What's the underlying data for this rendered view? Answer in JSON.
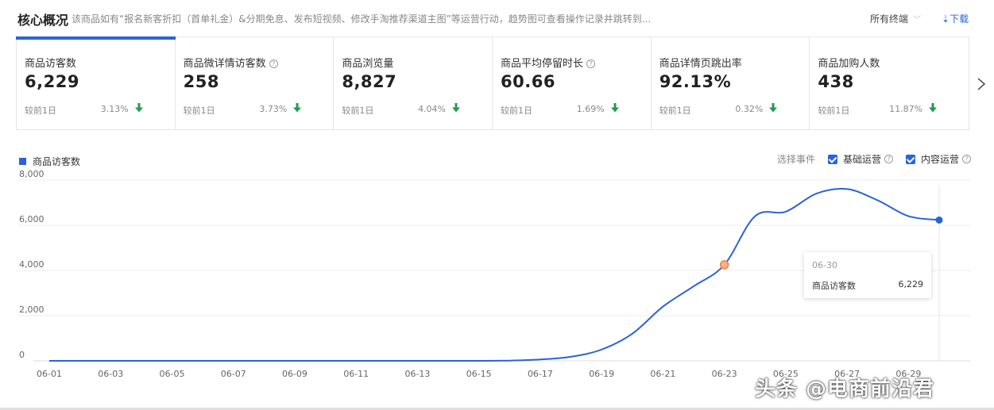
{
  "header": {
    "title": "核心概况",
    "description": "该商品如有“报名新客折扣（首单礼金）&分期免息、发布短视频、修改手淘推荐渠道主图”等运营行动，趋势图可查看操作记录并跳转到...",
    "terminal": "所有终端",
    "download": "下载"
  },
  "metrics": [
    {
      "label": "商品访客数",
      "value": "6,229",
      "compare": "较前1日",
      "change": "3.13%",
      "has_help": false
    },
    {
      "label": "商品微详情访客数",
      "value": "258",
      "compare": "较前1日",
      "change": "3.73%",
      "has_help": true
    },
    {
      "label": "商品浏览量",
      "value": "8,827",
      "compare": "较前1日",
      "change": "4.04%",
      "has_help": false
    },
    {
      "label": "商品平均停留时长",
      "value": "60.66",
      "compare": "较前1日",
      "change": "1.69%",
      "has_help": true
    },
    {
      "label": "商品详情页跳出率",
      "value": "92.13%",
      "compare": "较前1日",
      "change": "0.32%",
      "has_help": false
    },
    {
      "label": "商品加购人数",
      "value": "438",
      "compare": "较前1日",
      "change": "11.87%",
      "has_help": false
    }
  ],
  "legend": {
    "series_name": "商品访客数",
    "color": "#2a63d8"
  },
  "events": {
    "label": "选择事件",
    "options": [
      {
        "label": "基础运营",
        "checked": true
      },
      {
        "label": "内容运营",
        "checked": true
      }
    ]
  },
  "tooltip": {
    "date": "06-30",
    "name": "商品访客数",
    "value": "6,229"
  },
  "chart_data": {
    "type": "line",
    "x": [
      "06-01",
      "06-02",
      "06-03",
      "06-04",
      "06-05",
      "06-06",
      "06-07",
      "06-08",
      "06-09",
      "06-10",
      "06-11",
      "06-12",
      "06-13",
      "06-14",
      "06-15",
      "06-16",
      "06-17",
      "06-18",
      "06-19",
      "06-20",
      "06-21",
      "06-22",
      "06-23",
      "06-24",
      "06-25",
      "06-26",
      "06-27",
      "06-28",
      "06-29",
      "06-30"
    ],
    "xticks": [
      "06-01",
      "06-03",
      "06-05",
      "06-07",
      "06-09",
      "06-11",
      "06-13",
      "06-15",
      "06-17",
      "06-19",
      "06-21",
      "06-23",
      "06-25",
      "06-27",
      "06-29"
    ],
    "series": [
      {
        "name": "商品访客数",
        "color": "#2a63d8",
        "values": [
          0,
          0,
          0,
          0,
          0,
          0,
          0,
          0,
          0,
          0,
          0,
          0,
          0,
          0,
          0,
          10,
          60,
          180,
          500,
          1200,
          2400,
          3300,
          4250,
          6400,
          6600,
          7400,
          7600,
          7100,
          6400,
          6229
        ]
      }
    ],
    "yticks": [
      0,
      2000,
      4000,
      6000,
      8000
    ],
    "ylim": [
      0,
      8000
    ],
    "grid": true,
    "highlight_index": 22,
    "hover_index": 29
  },
  "watermark": "头条 @电商前沿君"
}
